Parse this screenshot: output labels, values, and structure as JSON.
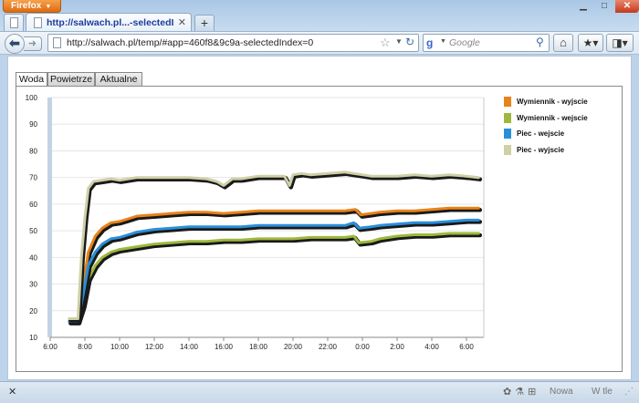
{
  "browser": {
    "app_button": "Firefox",
    "tab_title": "http://salwach.pl...-selectedIndex=0",
    "url": "http://salwach.pl/temp/#app=460f8&9c9a-selectedIndex=0",
    "search_placeholder": "Google",
    "status": {
      "nowa": "Nowa",
      "w_tle": "W tle"
    }
  },
  "page": {
    "tabs": [
      {
        "label": "Woda"
      },
      {
        "label": "Powietrze"
      },
      {
        "label": "Aktualne"
      }
    ]
  },
  "colors": {
    "wymiennik_wyjscie": "#e8821a",
    "wymiennik_wejscie": "#9db83c",
    "piec_wejscie": "#2a8fd8",
    "piec_wyjscie": "#cfcfa8"
  },
  "chart_data": {
    "type": "line",
    "ylim": [
      10,
      100
    ],
    "y_ticks": [
      10,
      20,
      30,
      40,
      50,
      60,
      70,
      80,
      90,
      100
    ],
    "x_ticks": [
      "6:00",
      "8:00",
      "10:00",
      "12:00",
      "14:00",
      "16:00",
      "18:00",
      "20:00",
      "22:00",
      "0:00",
      "2:00",
      "4:00",
      "6:00"
    ],
    "x_hours": [
      6,
      8,
      10,
      12,
      14,
      16,
      18,
      20,
      22,
      24,
      26,
      28,
      30
    ],
    "xlim": [
      6,
      31
    ],
    "grid": true,
    "legend_position": "right",
    "series": [
      {
        "name": "Wymiennik - wyjscie",
        "color_key": "wymiennik_wyjscie",
        "x": [
          7.1,
          7.6,
          7.9,
          8.2,
          8.6,
          9.0,
          9.5,
          10.0,
          10.5,
          11.0,
          12.0,
          13.0,
          14.0,
          15.0,
          16.0,
          17.0,
          18.0,
          19.0,
          20.0,
          21.0,
          22.0,
          23.0,
          23.6,
          23.9,
          24.5,
          25.0,
          26.0,
          27.0,
          28.0,
          29.0,
          30.0,
          30.7
        ],
        "y": [
          17,
          17,
          30,
          42,
          48,
          51,
          53,
          53.5,
          54.5,
          55.5,
          56,
          56.5,
          57,
          57,
          56.5,
          57,
          57.5,
          57.5,
          57.5,
          57.5,
          57.5,
          57.5,
          58,
          56,
          56.5,
          57,
          57.5,
          57.5,
          58,
          58.5,
          58.5,
          58.5
        ]
      },
      {
        "name": "Wymiennik - wejscie",
        "color_key": "wymiennik_wejscie",
        "x": [
          7.1,
          7.6,
          7.9,
          8.2,
          8.6,
          9.0,
          9.5,
          10.0,
          10.5,
          11.0,
          12.0,
          13.0,
          14.0,
          15.0,
          16.0,
          17.0,
          18.0,
          19.0,
          20.0,
          21.0,
          22.0,
          23.0,
          23.5,
          23.8,
          24.5,
          25.0,
          26.0,
          27.0,
          28.0,
          29.0,
          30.0,
          30.7
        ],
        "y": [
          16,
          16,
          22,
          32,
          37,
          40,
          42,
          43,
          43.5,
          44,
          45,
          45.5,
          46,
          46,
          46.5,
          46.5,
          47,
          47,
          47,
          47.5,
          47.5,
          47.5,
          48,
          45.5,
          46,
          47,
          48,
          48.5,
          48.5,
          49,
          49,
          49
        ]
      },
      {
        "name": "Piec - wejscie",
        "color_key": "piec_wejscie",
        "x": [
          7.1,
          7.6,
          7.9,
          8.2,
          8.6,
          9.0,
          9.5,
          10.0,
          10.5,
          11.0,
          12.0,
          13.0,
          14.0,
          15.0,
          16.0,
          17.0,
          18.0,
          19.0,
          20.0,
          21.0,
          22.0,
          23.0,
          23.5,
          23.8,
          24.5,
          25.0,
          26.0,
          27.0,
          28.0,
          29.0,
          30.0,
          30.7
        ],
        "y": [
          16,
          16,
          26,
          37,
          42,
          45,
          47,
          47.5,
          48.5,
          49.5,
          50.5,
          51,
          51.5,
          51.5,
          51.5,
          51.5,
          52,
          52,
          52,
          52,
          52,
          52,
          53,
          51,
          51.5,
          52,
          52.5,
          53,
          53,
          53.5,
          54,
          54
        ]
      },
      {
        "name": "Piec - wyjscie",
        "color_key": "piec_wyjscie",
        "x": [
          7.1,
          7.6,
          7.8,
          8.0,
          8.2,
          8.5,
          9.0,
          9.5,
          10.0,
          10.5,
          11.0,
          12.0,
          13.0,
          14.0,
          15.0,
          15.6,
          16.0,
          16.5,
          17.0,
          18.0,
          19.0,
          19.5,
          19.8,
          20.0,
          20.5,
          21.0,
          22.0,
          23.0,
          23.5,
          24.0,
          24.5,
          25.0,
          26.0,
          27.0,
          28.0,
          29.0,
          30.0,
          30.7
        ],
        "y": [
          17,
          17,
          40,
          55,
          66,
          68.5,
          69,
          69.5,
          69,
          69.5,
          70,
          70,
          70,
          70,
          69.5,
          68.5,
          67,
          69.5,
          69.5,
          70.5,
          70.5,
          70.5,
          67,
          71,
          71.5,
          71,
          71.5,
          72,
          71.5,
          71,
          70.5,
          70.5,
          70.5,
          71,
          70.5,
          71,
          70.5,
          70
        ]
      }
    ]
  }
}
